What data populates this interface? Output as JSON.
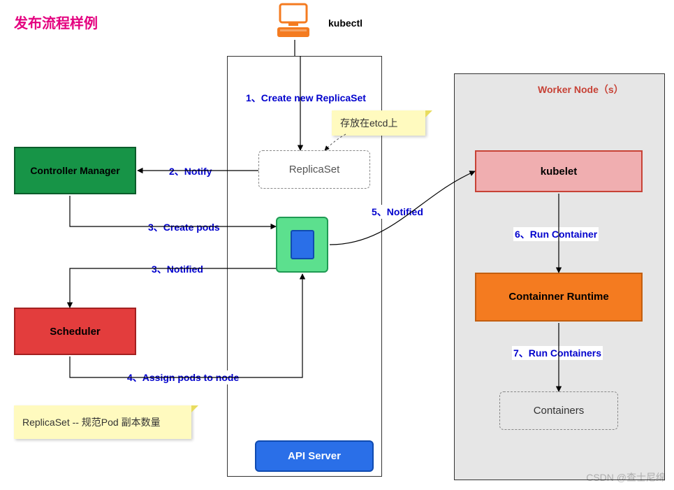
{
  "title": "发布流程样例",
  "kubectl_label": "kubectl",
  "worker_node_label": "Worker Node（s）",
  "boxes": {
    "controller_manager": "Controller Manager",
    "scheduler": "Scheduler",
    "replicaset": "ReplicaSet",
    "api_server": "API Server",
    "kubelet": "kubelet",
    "container_runtime": "Containner Runtime",
    "containers": "Containers"
  },
  "notes": {
    "etcd_note": "存放在etcd上",
    "replicaset_note": "ReplicaSet -- 规范Pod 副本数量"
  },
  "flows": {
    "step1": "1、Create new ReplicaSet",
    "step2": "2、Notify",
    "step3a": "3、Create pods",
    "step3b": "3、Notified",
    "step4": "4、Assign pods to node",
    "step5": "5、Notified",
    "step6": "6、Run Container",
    "step7": "7、Run Containers"
  },
  "watermark": "CSDN @查士尼绵"
}
